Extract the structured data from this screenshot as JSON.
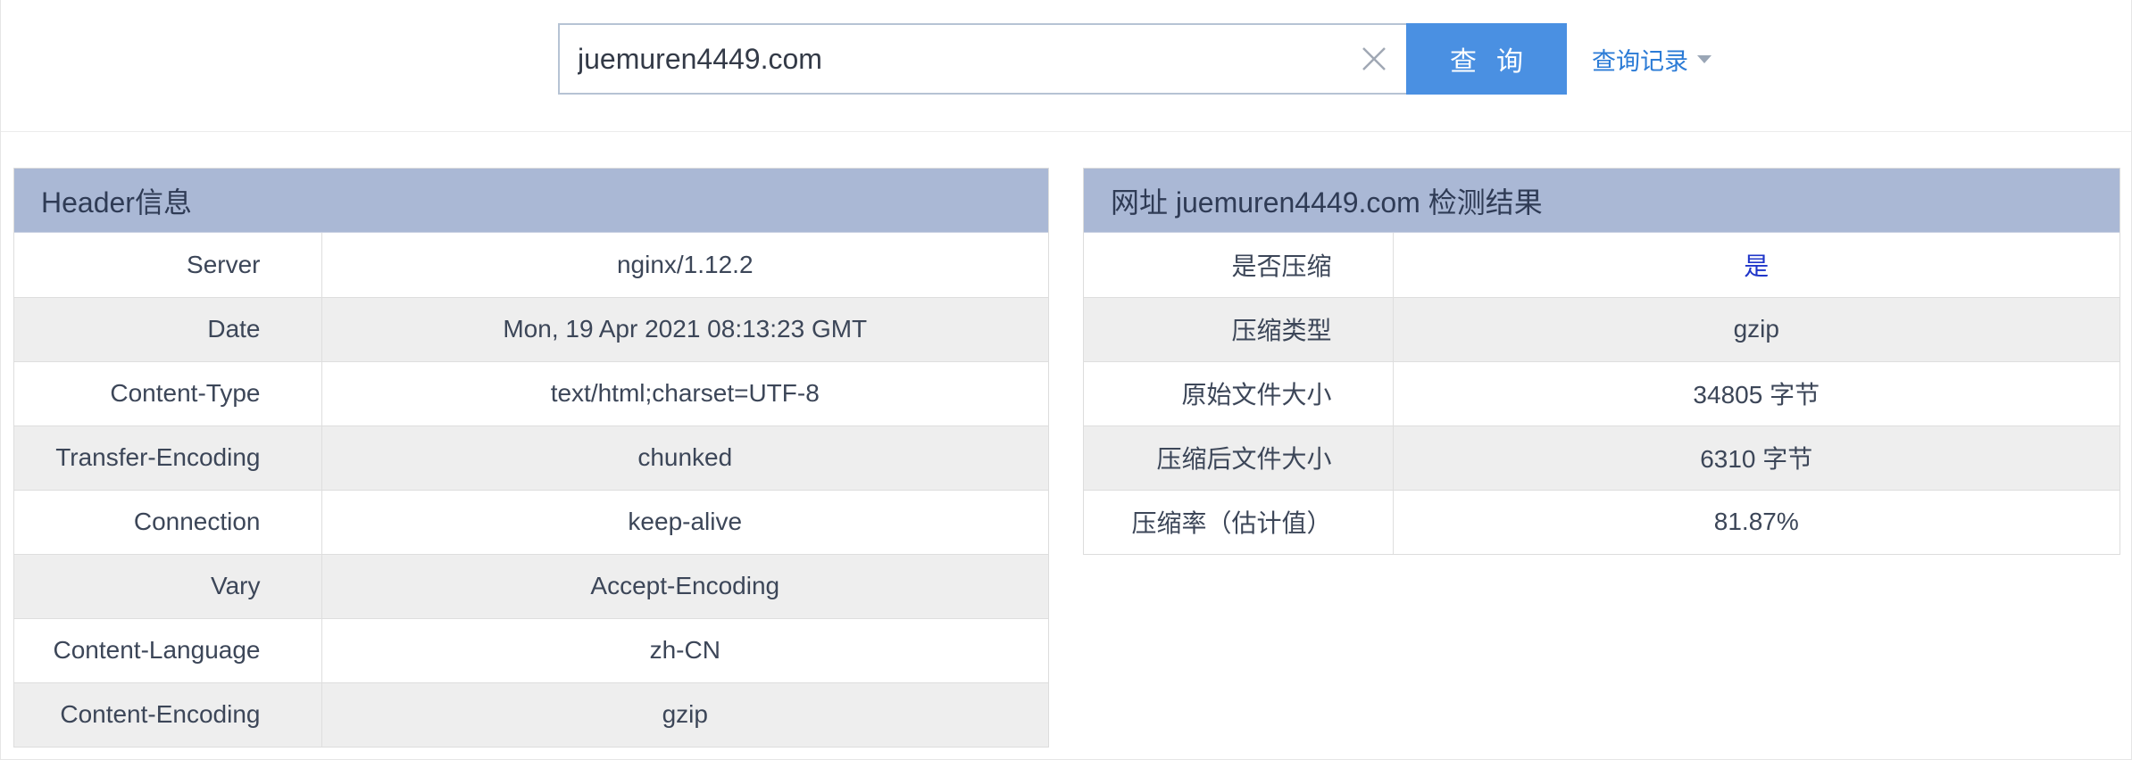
{
  "search": {
    "value": "juemuren4449.com",
    "button_label": "查询",
    "history_label": "查询记录"
  },
  "header_panel": {
    "title": "Header信息",
    "rows": [
      {
        "key": "Server",
        "value": "nginx/1.12.2"
      },
      {
        "key": "Date",
        "value": "Mon, 19 Apr 2021 08:13:23 GMT"
      },
      {
        "key": "Content-Type",
        "value": "text/html;charset=UTF-8"
      },
      {
        "key": "Transfer-Encoding",
        "value": "chunked"
      },
      {
        "key": "Connection",
        "value": "keep-alive"
      },
      {
        "key": "Vary",
        "value": "Accept-Encoding"
      },
      {
        "key": "Content-Language",
        "value": "zh-CN"
      },
      {
        "key": "Content-Encoding",
        "value": "gzip"
      }
    ]
  },
  "result_panel": {
    "title": "网址 juemuren4449.com 检测结果",
    "rows": [
      {
        "key": "是否压缩",
        "value": "是"
      },
      {
        "key": "压缩类型",
        "value": "gzip"
      },
      {
        "key": "原始文件大小",
        "value": "34805 字节"
      },
      {
        "key": "压缩后文件大小",
        "value": "6310 字节"
      },
      {
        "key": "压缩率（估计值）",
        "value": "81.87%"
      }
    ]
  },
  "colors": {
    "button": "#4a90e2",
    "panel_header": "#aab8d5",
    "link": "#2b7bd6",
    "highlight": "#1f35c9"
  }
}
